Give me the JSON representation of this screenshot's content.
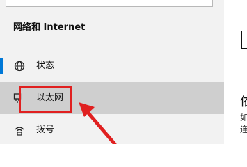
{
  "sidebar": {
    "section_title": "网络和 Internet",
    "items": [
      {
        "label": "状态",
        "icon": "globe-icon"
      },
      {
        "label": "以太网",
        "icon": "ethernet-icon"
      },
      {
        "label": "拨号",
        "icon": "dialup-icon"
      }
    ]
  },
  "content": {
    "heading": "依",
    "line1": "如",
    "line2": "连"
  },
  "annotation": {
    "highlight_color": "#e02020",
    "arrow_color": "#e02020"
  },
  "colors": {
    "accent": "#0078d7",
    "sidebar_bg": "#f2f2f2",
    "selected_bg": "#cfcfcf"
  }
}
